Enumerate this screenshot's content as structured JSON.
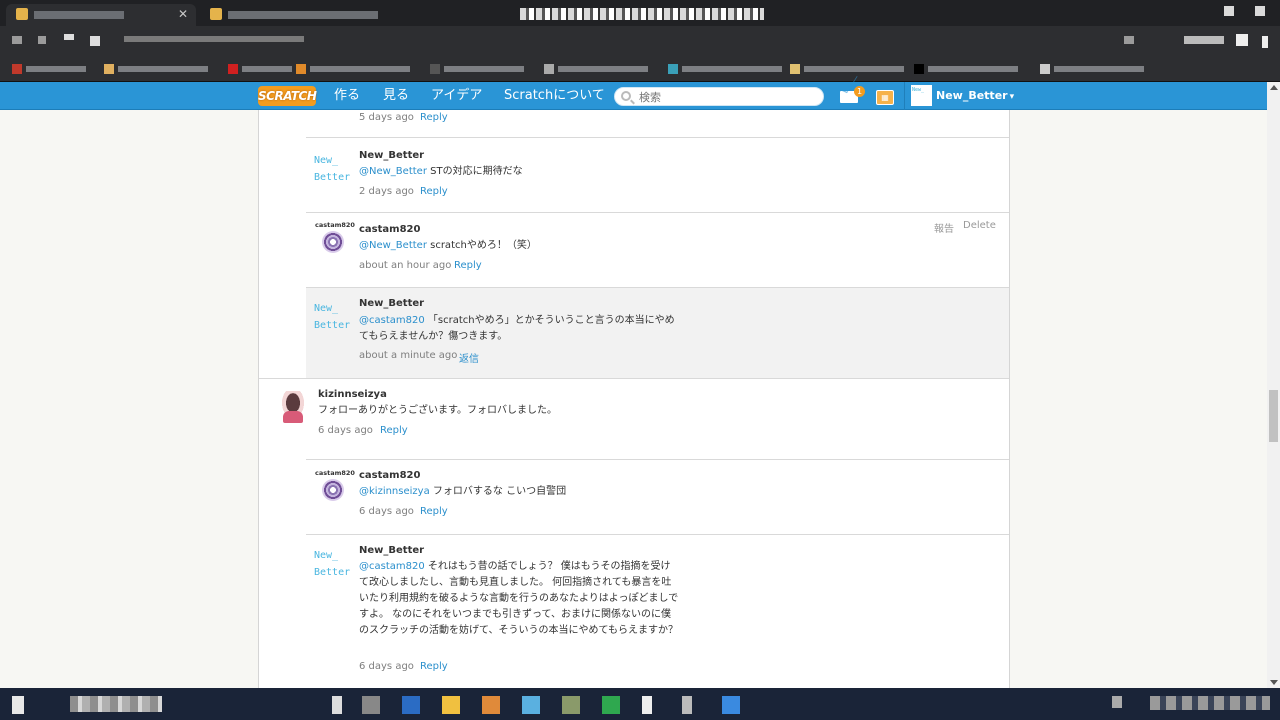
{
  "colors": {
    "nav": "#2a95d6",
    "link": "#2b8fcc",
    "orange": "#f39c1f"
  },
  "nav": {
    "logo": "SCRATCH",
    "links": [
      "作る",
      "見る",
      "アイデア",
      "Scratchについて"
    ],
    "search_placeholder": "検索",
    "messages_count": "1",
    "user": "New_Better",
    "avatar_text": "New_"
  },
  "comments": [
    {
      "time": "5 days ago",
      "reply": "Reply"
    },
    {
      "user": "New_Better",
      "mention": "@New_Better",
      "text": " STの対応に期待だな",
      "time": "2 days ago",
      "reply": "Reply",
      "avatar_lines": [
        "New_",
        "Better"
      ]
    },
    {
      "user": "castam820",
      "mention": "@New_Better",
      "text": " scratchやめろ！（笑）",
      "time": "about an hour ago",
      "reply": "Reply",
      "report": "報告",
      "delete": "Delete",
      "avatar_name": "castam820"
    },
    {
      "user": "New_Better",
      "mention": "@castam820",
      "text": " 「scratchやめろ」とかそういうこと言うの本当にやめてもらえませんか？傷つきます。",
      "time": "about a minute ago",
      "reply": "返信",
      "avatar_lines": [
        "New_",
        "Better"
      ]
    },
    {
      "user": "kizinnseizya",
      "text": "フォローありがとうございます。フォロバしました。",
      "time": "6 days ago",
      "reply": "Reply"
    },
    {
      "user": "castam820",
      "mention": "@kizinnseizya",
      "text": " フォロバするな こいつ自警団",
      "time": "6 days ago",
      "reply": "Reply",
      "avatar_name": "castam820"
    },
    {
      "user": "New_Better",
      "mention": "@castam820",
      "text": " それはもう昔の話でしょう？ 僕はもうその指摘を受けて改心しましたし、言動も見直しました。 何回指摘されても暴言を吐いたり利用規約を破るような言動を行うのあなたよりはよっぽどましですよ。 なのにそれをいつまでも引きずって、おまけに関係ないのに僕のスクラッチの活動を妨げて、そういうの本当にやめてもらえますか？",
      "time": "6 days ago",
      "reply": "Reply",
      "avatar_lines": [
        "New_",
        "Better"
      ]
    }
  ]
}
